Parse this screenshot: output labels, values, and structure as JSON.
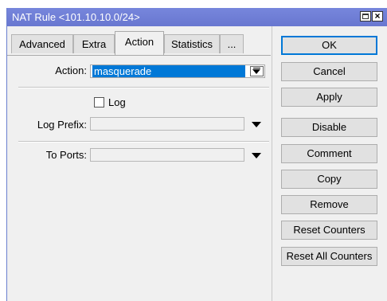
{
  "window": {
    "title": "NAT Rule <101.10.10.0/24>"
  },
  "tabs": [
    {
      "label": "Advanced"
    },
    {
      "label": "Extra"
    },
    {
      "label": "Action"
    },
    {
      "label": "Statistics"
    },
    {
      "label": "..."
    }
  ],
  "active_tab": "Action",
  "form": {
    "action_label": "Action:",
    "action_value": "masquerade",
    "log_label": "Log",
    "log_checked": false,
    "log_prefix_label": "Log Prefix:",
    "log_prefix_value": "",
    "to_ports_label": "To Ports:",
    "to_ports_value": ""
  },
  "buttons": {
    "ok": "OK",
    "cancel": "Cancel",
    "apply": "Apply",
    "disable": "Disable",
    "comment": "Comment",
    "copy": "Copy",
    "remove": "Remove",
    "reset_counters": "Reset Counters",
    "reset_all_counters": "Reset All Counters"
  },
  "colors": {
    "titlebar": "#6f7fd7",
    "selection": "#0078d7",
    "default_button_border": "#0078d7"
  }
}
